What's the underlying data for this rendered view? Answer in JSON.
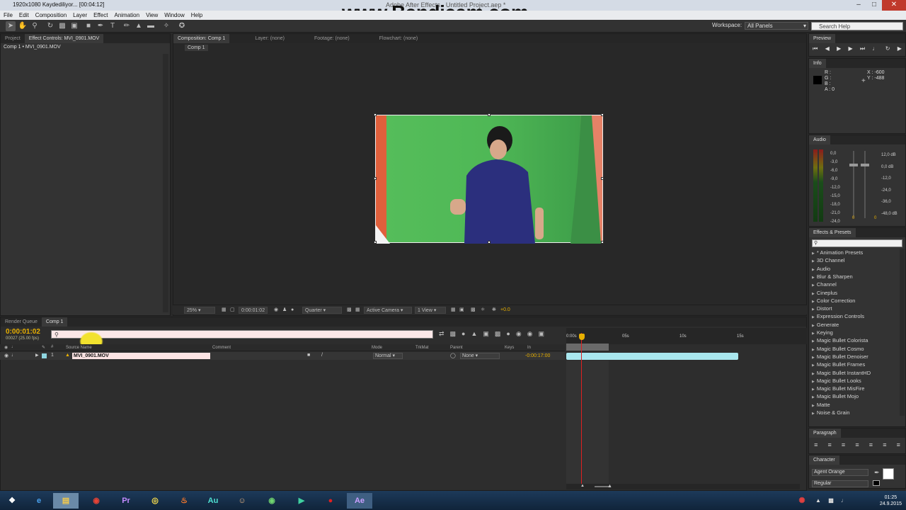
{
  "titlebar": {
    "recorder_status": "1920x1080  Kaydediliyor... [00:04:12]",
    "app_title": "Adobe After Effects - Untitled Project.aep *",
    "watermark": "www.Bandicam.com"
  },
  "menu": [
    "File",
    "Edit",
    "Composition",
    "Layer",
    "Effect",
    "Animation",
    "View",
    "Window",
    "Help"
  ],
  "toolbar": {
    "workspace_label": "Workspace:",
    "workspace_value": "All Panels",
    "search_placeholder": "Search Help"
  },
  "left_panel": {
    "tabs": [
      "Project",
      "Effect Controls: MVI_0901.MOV"
    ],
    "breadcrumb": "Comp 1 • MVI_0901.MOV"
  },
  "comp_panel": {
    "tabs": [
      "Composition: Comp 1",
      "Layer: (none)",
      "Footage: (none)",
      "Flowchart: (none)"
    ],
    "subtab": "Comp 1",
    "zoom": "25%",
    "timecode": "0:00:01:02",
    "resolution": "Quarter",
    "camera": "Active Camera",
    "views": "1 View",
    "exposure": "+0.0"
  },
  "preview": {
    "tab": "Preview"
  },
  "info": {
    "tab": "Info",
    "r": "R :",
    "g": "G :",
    "b": "B :",
    "a": "A : 0",
    "x": "X : -600",
    "y": "Y : -488"
  },
  "audio": {
    "tab": "Audio",
    "left_scale": [
      "0,0",
      "-3,0",
      "-6,0",
      "-9,0",
      "-12,0",
      "-15,0",
      "-18,0",
      "-21,0",
      "-24,0"
    ],
    "right_scale": [
      "12,0 dB",
      "0,0 dB",
      "-12,0",
      "-24,0",
      "-36,0",
      "-48,0 dB"
    ],
    "slider_values": [
      "0",
      "0"
    ]
  },
  "effects": {
    "tab": "Effects & Presets",
    "search_placeholder": "",
    "items": [
      "* Animation Presets",
      "3D Channel",
      "Audio",
      "Blur & Sharpen",
      "Channel",
      "Cineplus",
      "Color Correction",
      "Distort",
      "Expression Controls",
      "Generate",
      "Keying",
      "Magic Bullet Colorista",
      "Magic Bullet Cosmo",
      "Magic Bullet Denoiser",
      "Magic Bullet Frames",
      "Magic Bullet InstantHD",
      "Magic Bullet Looks",
      "Magic Bullet MisFire",
      "Magic Bullet Mojo",
      "Matte",
      "Noise & Grain"
    ]
  },
  "paragraph": {
    "tab": "Paragraph"
  },
  "character": {
    "tab": "Character",
    "font": "Agent Orange",
    "style": "Regular"
  },
  "timeline": {
    "tabs": [
      "Render Queue",
      "Comp 1"
    ],
    "timecode": "0:00:01:02",
    "fps": "00027 (25.00 fps)",
    "columns": {
      "source": "Source Name",
      "comment": "Comment",
      "mode": "Mode",
      "trkmat": "TrkMat",
      "parent": "Parent",
      "keys": "Keys",
      "in": "In"
    },
    "layer": {
      "index": "1",
      "name": "MVI_0901.MOV",
      "mode": "Normal",
      "parent": "None",
      "in_point": "-0:00:17:00"
    },
    "ruler": [
      "0:00s",
      "05s",
      "10s",
      "15s"
    ]
  },
  "taskbar": {
    "apps": [
      "IE",
      "Explorer",
      "Chrome",
      "Premiere",
      "Cinema",
      "Fruity",
      "Audition",
      "Gimp",
      "Chrome2",
      "Camtasia",
      "Bandicam",
      "After Effects"
    ],
    "time": "01:25",
    "date": "24.9.2015"
  }
}
